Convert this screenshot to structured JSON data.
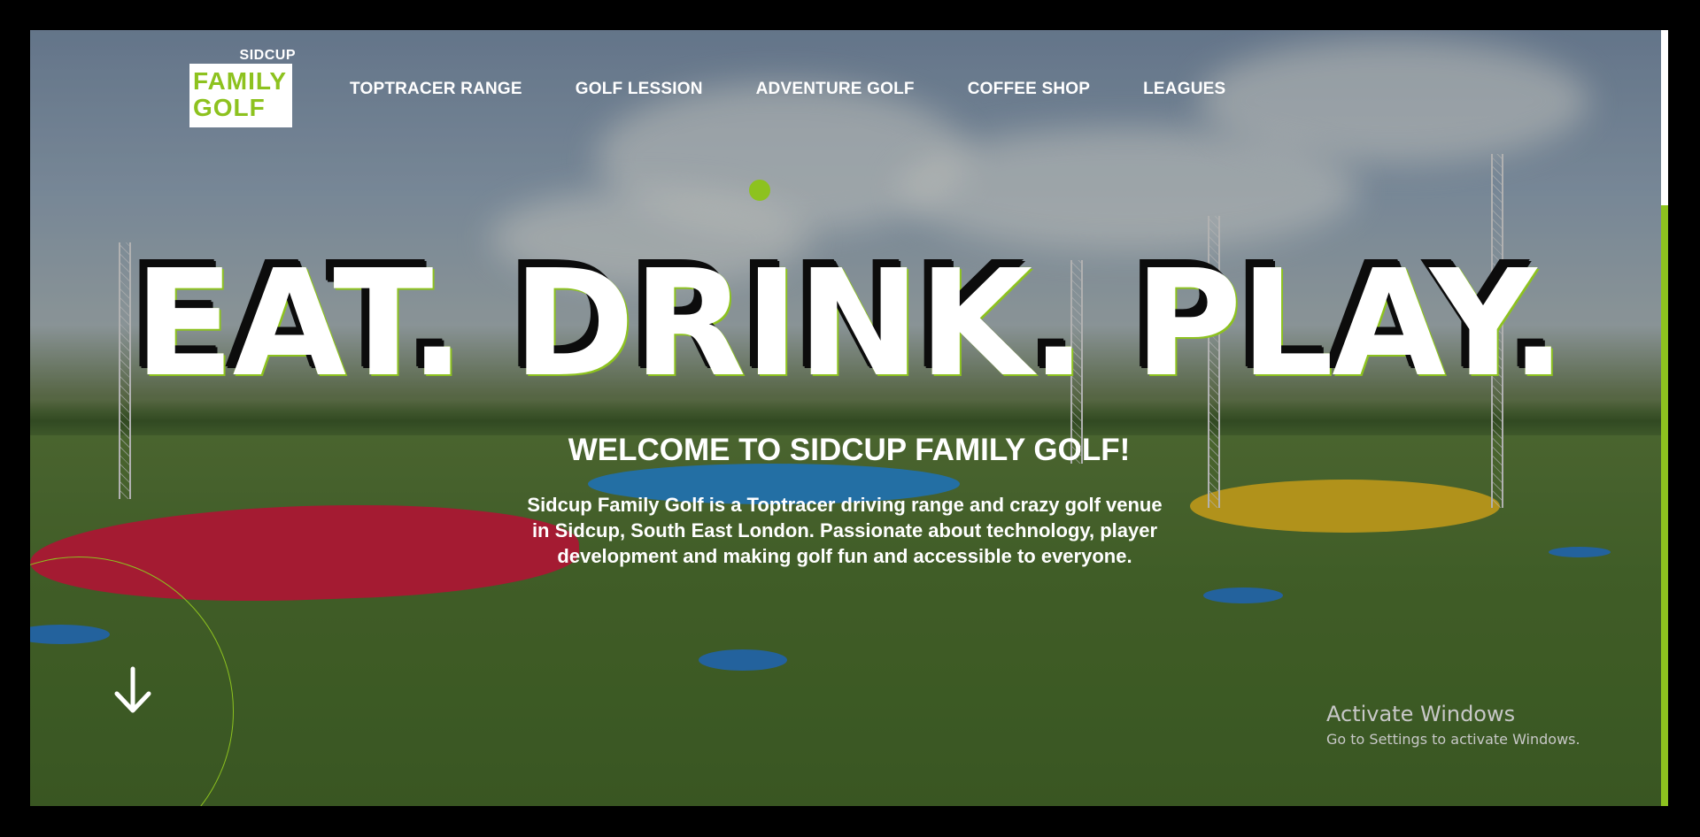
{
  "logo": {
    "top": "SIDCUP",
    "line1": "FAMILY",
    "line2": "GOLF"
  },
  "nav": {
    "items": [
      {
        "label": "TOPTRACER RANGE"
      },
      {
        "label": "GOLF LESSION"
      },
      {
        "label": "ADVENTURE GOLF"
      },
      {
        "label": "COFFEE SHOP"
      },
      {
        "label": "LEAGUES"
      }
    ]
  },
  "hero": {
    "headline": "EAT. DRINK. PLAY.",
    "welcome": "WELCOME TO SIDCUP FAMILY GOLF!",
    "description": "Sidcup Family Golf is a Toptracer driving range and crazy golf venue in Sidcup, South East London. Passionate about technology, player development and making golf fun and accessible to everyone."
  },
  "scroll_down": {
    "icon": "arrow-down-icon"
  },
  "watermark": {
    "title": "Activate Windows",
    "subtitle": "Go to Settings to activate Windows."
  },
  "colors": {
    "accent": "#8dc21f",
    "text": "#ffffff",
    "background": "#000000"
  }
}
